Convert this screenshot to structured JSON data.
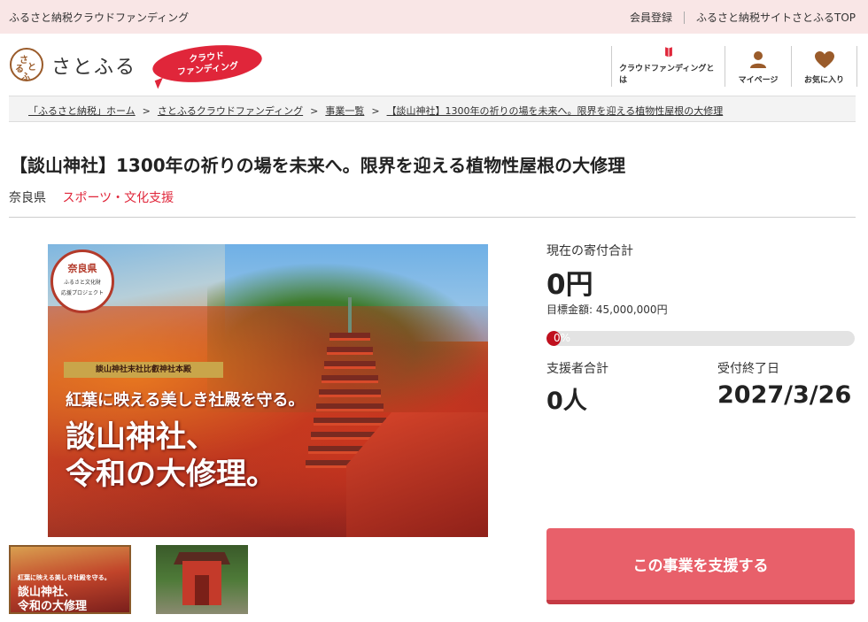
{
  "topbar": {
    "site_name": "ふるさと納税クラウドファンディング",
    "links": [
      "会員登録",
      "ふるさと納税サイトさとふるTOP"
    ]
  },
  "header": {
    "logo_mark": [
      "さ",
      "と",
      "ふ",
      "る"
    ],
    "logo_text": "さとふる",
    "badge_line1": "クラウド",
    "badge_line2": "ファンディング",
    "nav": [
      {
        "label": "クラウドファンディングとは",
        "icon": "book-icon"
      },
      {
        "label": "マイページ",
        "icon": "user-icon"
      },
      {
        "label": "お気に入り",
        "icon": "heart-icon"
      }
    ]
  },
  "breadcrumb": [
    "「ふるさと納税」ホーム",
    "さとふるクラウドファンディング",
    "事業一覧",
    "【談山神社】1300年の祈りの場を未来へ。限界を迎える植物性屋根の大修理"
  ],
  "page": {
    "title": "【談山神社】1300年の祈りの場を未来へ。限界を迎える植物性屋根の大修理",
    "prefecture": "奈良県",
    "category": "スポーツ・文化支援"
  },
  "main_image": {
    "seal_title": "奈良県",
    "seal_line1": "ふるさと文化財",
    "seal_line2": "応援プロジェクト",
    "subtitle": "談山神社末社比叡神社本殿",
    "line1": "紅葉に映える美しき社殿を守る。",
    "line2": "談山神社、",
    "line3": "令和の大修理。"
  },
  "thumbnails": {
    "thumb1_line1": "紅葉に映える美しき社殿を守る。",
    "thumb1_line2": "談山神社、",
    "thumb1_line3": "令和の大修理"
  },
  "stats": {
    "total_label": "現在の寄付合計",
    "total_value": "0円",
    "target_text": "目標金額: 45,000,000円",
    "progress_text": "0%",
    "progress_fraction": 0,
    "supporters_label": "支援者合計",
    "supporters_value": "0人",
    "deadline_label": "受付終了日",
    "deadline_value": "2027/3/26"
  },
  "cta": {
    "label": "この事業を支援する"
  },
  "colors": {
    "accent_red": "#e0263a",
    "button": "#e8606a",
    "topbar_bg": "#f9e6e6"
  }
}
